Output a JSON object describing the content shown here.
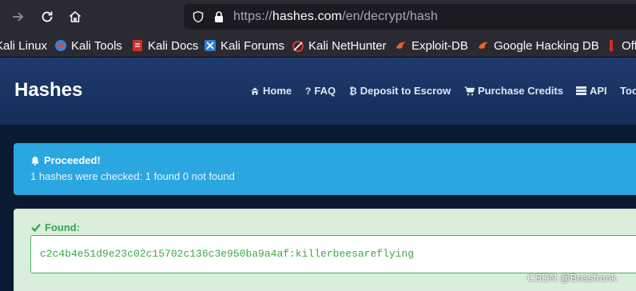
{
  "browser": {
    "url_prefix": "https://",
    "url_host": "hashes.com",
    "url_path": "/en/decrypt/hash",
    "bookmarks": [
      {
        "label": "Kali Linux",
        "icon": "kali-icon"
      },
      {
        "label": "Kali Tools",
        "icon": "kali-tools-icon"
      },
      {
        "label": "Kali Docs",
        "icon": "kali-docs-icon"
      },
      {
        "label": "Kali Forums",
        "icon": "kali-forums-icon"
      },
      {
        "label": "Kali NetHunter",
        "icon": "nethunter-icon"
      },
      {
        "label": "Exploit-DB",
        "icon": "exploit-db-icon"
      },
      {
        "label": "Google Hacking DB",
        "icon": "ghdb-icon"
      },
      {
        "label": "Off",
        "icon": "offsec-icon"
      }
    ]
  },
  "site": {
    "brand": "Hashes",
    "nav": [
      {
        "label": "Home",
        "icon": "home-icon"
      },
      {
        "label": "FAQ",
        "icon": "question-icon"
      },
      {
        "label": "Deposit to Escrow",
        "icon": "bitcoin-icon"
      },
      {
        "label": "Purchase Credits",
        "icon": "cart-icon"
      },
      {
        "label": "API",
        "icon": "list-icon"
      },
      {
        "label": "Too",
        "icon": ""
      }
    ]
  },
  "alert": {
    "title": "Proceeded!",
    "message": "1 hashes were checked: 1 found 0 not found"
  },
  "result": {
    "label": "Found:",
    "value": "c2c4b4e51d9e23c02c15702c136c3e950ba9a4af:killerbeesareflying"
  },
  "watermark": "CSDN @Bossfrank",
  "colors": {
    "info_alert": "#2aa6e0",
    "found_green": "#3aa845",
    "header_blue": "#1e3a6e"
  }
}
